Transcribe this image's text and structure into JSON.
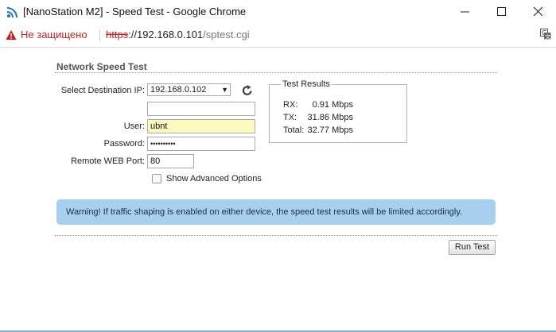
{
  "window": {
    "title": "[NanoStation M2] - Speed Test - Google Chrome",
    "controls": [
      "minimize",
      "maximize",
      "close"
    ]
  },
  "addressbar": {
    "security_text": "Не защищено",
    "url_scheme": "https",
    "url_host": "://192.168.0.101",
    "url_path": "/sptest.cgi"
  },
  "page": {
    "section_title": "Network Speed Test",
    "form": {
      "destination_label": "Select Destination IP:",
      "destination_value": "192.168.0.102",
      "extra_ip_value": "",
      "user_label": "User:",
      "user_value": "ubnt",
      "password_label": "Password:",
      "password_value": "••••••••••",
      "port_label": "Remote WEB Port:",
      "port_value": "80",
      "advanced_label": "Show Advanced Options",
      "advanced_checked": false
    },
    "results": {
      "legend": "Test Results",
      "rx_label": "RX:",
      "rx_value": "0.91 Mbps",
      "tx_label": "TX:",
      "tx_value": "31.86 Mbps",
      "total_label": "Total:",
      "total_value": "32.77 Mbps"
    },
    "warning_text": "Warning! If traffic shaping is enabled on either device, the speed test results will be limited accordingly.",
    "run_button_label": "Run Test"
  },
  "colors": {
    "insecure_red": "#c5221f",
    "warning_bg": "#a6d0ee",
    "autofill_yellow": "#fbfbbd"
  },
  "icons": {
    "app": "wifi-feed-icon",
    "warning": "warning-triangle-icon",
    "refresh": "refresh-icon",
    "translate": "translate-icon"
  }
}
